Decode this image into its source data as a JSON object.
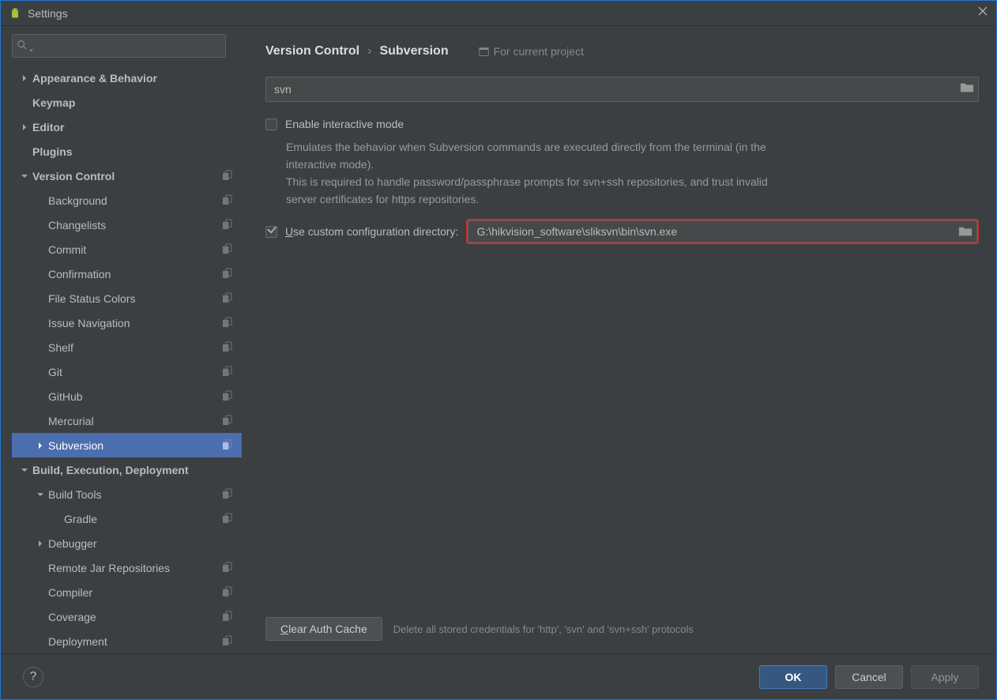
{
  "title": "Settings",
  "breadcrumb": {
    "a": "Version Control",
    "b": "Subversion",
    "scope": "For current project"
  },
  "search": {
    "placeholder": "",
    "value": ""
  },
  "svn": {
    "pathInput": "svn",
    "enableInteractiveLabel": "Enable interactive mode",
    "enableInteractiveDesc": "Emulates the behavior when Subversion commands are executed directly from the terminal (in the interactive mode).\nThis is required to handle password/passphrase prompts for svn+ssh repositories, and trust invalid server certificates for https repositories.",
    "useCustomDirPrefix": "U",
    "useCustomDirRest": "se custom configuration directory:",
    "customDir": "G:\\hikvision_software\\sliksvn\\bin\\svn.exe",
    "clearBtnPrefix": "C",
    "clearBtnRest": "lear Auth Cache",
    "clearHint": "Delete all stored credentials for 'http', 'svn' and 'svn+ssh' protocols"
  },
  "tree": [
    {
      "label": "Appearance & Behavior",
      "bold": true,
      "exp": true,
      "ind": 0,
      "chev": "right"
    },
    {
      "label": "Keymap",
      "bold": true,
      "ind": 0
    },
    {
      "label": "Editor",
      "bold": true,
      "exp": true,
      "ind": 0,
      "chev": "right"
    },
    {
      "label": "Plugins",
      "bold": true,
      "ind": 0
    },
    {
      "label": "Version Control",
      "bold": true,
      "ind": 0,
      "chev": "down",
      "tag": true
    },
    {
      "label": "Background",
      "ind": 1,
      "tag": true
    },
    {
      "label": "Changelists",
      "ind": 1,
      "tag": true
    },
    {
      "label": "Commit",
      "ind": 1,
      "tag": true
    },
    {
      "label": "Confirmation",
      "ind": 1,
      "tag": true
    },
    {
      "label": "File Status Colors",
      "ind": 1,
      "tag": true
    },
    {
      "label": "Issue Navigation",
      "ind": 1,
      "tag": true
    },
    {
      "label": "Shelf",
      "ind": 1,
      "tag": true
    },
    {
      "label": "Git",
      "ind": 1,
      "tag": true
    },
    {
      "label": "GitHub",
      "ind": 1,
      "tag": true
    },
    {
      "label": "Mercurial",
      "ind": 1,
      "tag": true
    },
    {
      "label": "Subversion",
      "ind": 1,
      "tag": true,
      "sel": true,
      "chev": "right"
    },
    {
      "label": "Build, Execution, Deployment",
      "bold": true,
      "ind": 0,
      "chev": "down"
    },
    {
      "label": "Build Tools",
      "ind": 1,
      "chev": "down",
      "tag": true
    },
    {
      "label": "Gradle",
      "ind": 2,
      "tag": true
    },
    {
      "label": "Debugger",
      "ind": 1,
      "chev": "right"
    },
    {
      "label": "Remote Jar Repositories",
      "ind": 1,
      "tag": true
    },
    {
      "label": "Compiler",
      "ind": 1,
      "tag": true
    },
    {
      "label": "Coverage",
      "ind": 1,
      "tag": true
    },
    {
      "label": "Deployment",
      "ind": 1,
      "tag": true
    }
  ],
  "buttons": {
    "ok": "OK",
    "cancel": "Cancel",
    "apply": "Apply"
  }
}
